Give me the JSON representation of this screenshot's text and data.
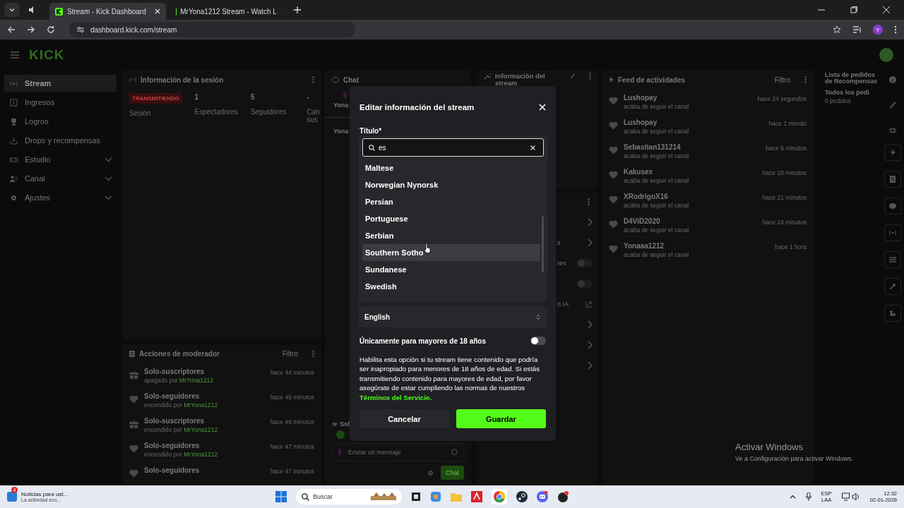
{
  "browser": {
    "tabs": [
      {
        "title": "Stream - Kick Dashboard",
        "selected": true
      },
      {
        "title": "MrYona1212 Stream - Watch L",
        "selected": false
      }
    ],
    "url": "dashboard.kick.com/stream",
    "profile": "Y"
  },
  "header": {
    "logo": "KICK"
  },
  "sidebar": {
    "items": [
      {
        "label": "Stream",
        "selected": true,
        "has_submenu": false
      },
      {
        "label": "Ingresos",
        "selected": false,
        "has_submenu": false
      },
      {
        "label": "Logros",
        "selected": false,
        "has_submenu": false
      },
      {
        "label": "Drops y recompensas",
        "selected": false,
        "has_submenu": false
      },
      {
        "label": "Estudio",
        "selected": false,
        "has_submenu": true
      },
      {
        "label": "Canal",
        "selected": false,
        "has_submenu": true
      },
      {
        "label": "Ajustes",
        "selected": false,
        "has_submenu": true
      }
    ]
  },
  "session": {
    "title": "Información de la sesión",
    "badge": "TRANSMITIENDO",
    "badge_label": "Sesión",
    "stats": [
      {
        "value": "1",
        "label": "Espectadores"
      },
      {
        "value": "5",
        "label": "Seguidores"
      },
      {
        "value": "-",
        "label": "Can sus"
      }
    ]
  },
  "moderator": {
    "title": "Acciones de moderador",
    "filter": "Filtro",
    "rows": [
      {
        "kind": "gift",
        "title": "Solo-suscriptores",
        "action": "apagado por",
        "user": "MrYona1212",
        "time": "hace 44 minutos"
      },
      {
        "kind": "heart",
        "title": "Solo-seguidores",
        "action": "encendido por",
        "user": "MrYona1212",
        "time": "hace 45 minutos"
      },
      {
        "kind": "gift",
        "title": "Solo-suscriptores",
        "action": "encendido por",
        "user": "MrYona1212",
        "time": "hace 46 minutos"
      },
      {
        "kind": "heart",
        "title": "Solo-seguidores",
        "action": "encendido por",
        "user": "MrYona1212",
        "time": "hace 47 minutos"
      },
      {
        "kind": "heart",
        "title": "Solo-seguidores",
        "time": "hace 47 minutos"
      }
    ]
  },
  "chat": {
    "title": "Chat",
    "lines": [
      "Yona",
      "Yona"
    ],
    "pinned": "Sol",
    "placeholder": "Enviar un mensaje",
    "send": "Chat"
  },
  "stream_info": {
    "title": "Información del stream",
    "rows": [
      {
        "kind": "chevron"
      },
      {
        "kind": "chevron",
        "text": "s"
      },
      {
        "kind": "toggle",
        "text": "res",
        "on": false
      },
      {
        "kind": "toggle",
        "on": false
      },
      {
        "kind": "external",
        "text": "n IA"
      },
      {
        "kind": "chevron"
      },
      {
        "kind": "chevron"
      },
      {
        "kind": "chevron"
      }
    ]
  },
  "feed": {
    "title": "Feed de actividades",
    "filter": "Filtro",
    "items": [
      {
        "name": "Lushopay",
        "text": "acaba de seguir el canal",
        "time": "hace 24 segundos"
      },
      {
        "name": "Lushopay",
        "text": "acaba de seguir el canal",
        "time": "hace 1 minuto"
      },
      {
        "name": "Sebastian131214",
        "text": "acaba de seguir el canal",
        "time": "hace 6 minutos"
      },
      {
        "name": "Kakusex",
        "text": "acaba de seguir el canal",
        "time": "hace 10 minutos"
      },
      {
        "name": "XRodrigoX16",
        "text": "acaba de seguir el canal",
        "time": "hace 21 minutos"
      },
      {
        "name": "D4ViD2020",
        "text": "acaba de seguir el canal",
        "time": "hace 24 minutos"
      },
      {
        "name": "Yonaaa1212",
        "text": "acaba de seguir el canal",
        "time": "hace 1 hora"
      }
    ]
  },
  "rewards": {
    "title": "Lista de pedidos de Recompensas",
    "tab": "Todos los pedi",
    "count": "0 pedidos"
  },
  "modal": {
    "title": "Editar información del stream",
    "field_label": "Título*",
    "search": "es",
    "options": [
      {
        "label": "Maltese",
        "selected": false
      },
      {
        "label": "Norwegian Nynorsk",
        "selected": false
      },
      {
        "label": "Persian",
        "selected": false
      },
      {
        "label": "Portuguese",
        "selected": false
      },
      {
        "label": "Serbian",
        "selected": false
      },
      {
        "label": "Southern Sotho",
        "selected": true
      },
      {
        "label": "Sundanese",
        "selected": false
      },
      {
        "label": "Swedish",
        "selected": false
      }
    ],
    "language": "English",
    "adult_label": "Únicamente para mayores de 18 años",
    "adult_on": false,
    "adult_text": "Habilita esta opción si tu stream tiene contenido que podría ser inapropiado para menores de 18 años de edad. Si estás transmitiendo contenido para mayores de edad, por favor asegúrate de estar cumpliendo las normas de nuestros",
    "adult_link": "Términos del Servicio.",
    "cancel": "Cancelar",
    "save": "Guardar"
  },
  "windows_notice": {
    "title": "Activar Windows",
    "text": "Ve a Configuración para activar Windows."
  },
  "taskbar": {
    "news_badge": "4",
    "news_title": "Noticias para ust...",
    "news_text": "La actividad eco...",
    "placeholder": "Buscar",
    "lang": "ESP",
    "lang2": "LAA",
    "time": "12:32",
    "date": "02-01-2026"
  }
}
